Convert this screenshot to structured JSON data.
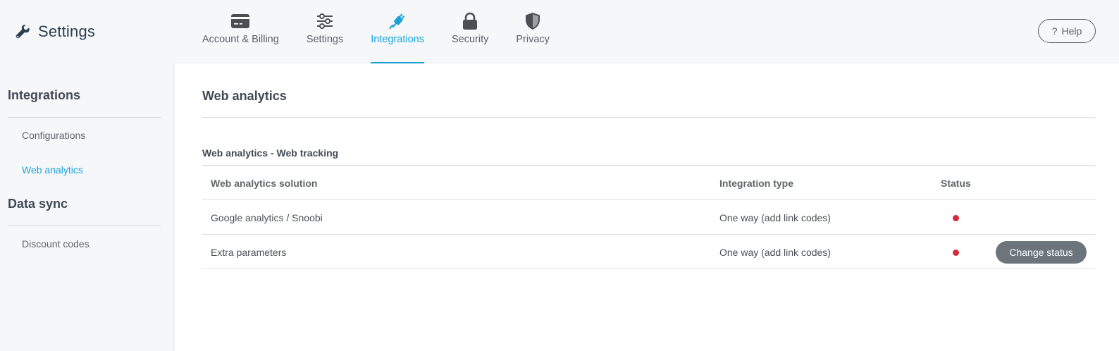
{
  "header": {
    "brand_title": "Settings",
    "brand_icon": "wrench-icon",
    "help_label": "Help",
    "tabs": [
      {
        "label": "Account & Billing",
        "icon": "credit-card-icon",
        "active": false
      },
      {
        "label": "Settings",
        "icon": "sliders-icon",
        "active": false
      },
      {
        "label": "Integrations",
        "icon": "plug-icon",
        "active": true
      },
      {
        "label": "Security",
        "icon": "lock-icon",
        "active": false
      },
      {
        "label": "Privacy",
        "icon": "shield-icon",
        "active": false
      }
    ]
  },
  "sidebar": {
    "sections": [
      {
        "title": "Integrations",
        "items": [
          "Configurations",
          "Web analytics"
        ]
      },
      {
        "title": "Data sync",
        "items": [
          "Discount codes"
        ]
      }
    ],
    "active_item": "Web analytics"
  },
  "main": {
    "title": "Web analytics",
    "section_title": "Web analytics - Web tracking",
    "columns": [
      "Web analytics solution",
      "Integration type",
      "Status"
    ],
    "rows": [
      {
        "solution": "Google analytics / Snoobi",
        "type": "One way (add link codes)",
        "status": "inactive",
        "action": ""
      },
      {
        "solution": "Extra parameters",
        "type": "One way (add link codes)",
        "status": "inactive",
        "action": "Change status"
      }
    ]
  },
  "colors": {
    "accent": "#1aa3d9",
    "status_inactive": "#d62a3a",
    "button_gray": "#6c757c"
  }
}
